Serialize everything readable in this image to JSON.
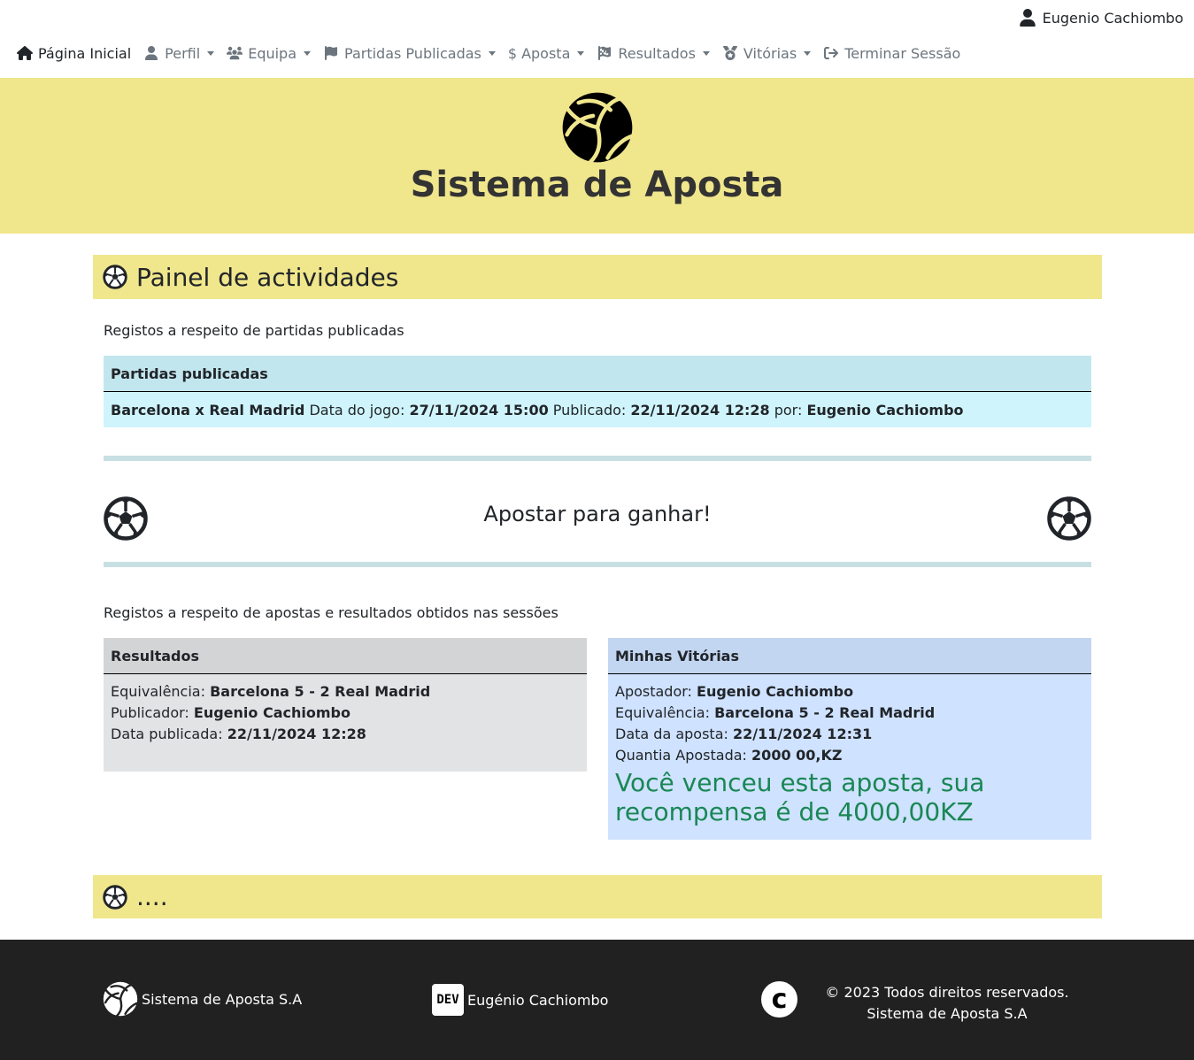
{
  "user": {
    "name": "Eugenio Cachiombo",
    "icon": "user-icon"
  },
  "nav": {
    "items": [
      {
        "label": "Página Inicial",
        "icon": "home-icon",
        "active": true,
        "dropdown": false
      },
      {
        "label": "Perfil",
        "icon": "user-icon",
        "dropdown": true
      },
      {
        "label": "Equipa",
        "icon": "users-icon",
        "dropdown": true
      },
      {
        "label": "Partidas Publicadas",
        "icon": "flag-icon",
        "dropdown": true
      },
      {
        "label": "Aposta",
        "icon": "dollar-icon",
        "dropdown": true
      },
      {
        "label": "Resultados",
        "icon": "checkered-flag-icon",
        "dropdown": true
      },
      {
        "label": "Vitórias",
        "icon": "medal-icon",
        "dropdown": true
      },
      {
        "label": "Terminar Sessão",
        "icon": "logout-icon",
        "dropdown": false
      }
    ]
  },
  "hero": {
    "title": "Sistema de Aposta",
    "logo": "volleyball-icon"
  },
  "panel": {
    "title": "Painel de actividades"
  },
  "published": {
    "caption": "Registos a respeito de partidas publicadas",
    "header": "Partidas publicadas",
    "match": "Barcelona x Real Madrid",
    "game_date_label": "Data do jogo:",
    "game_date": "27/11/2024 15:00",
    "published_label": "Publicado:",
    "published_date": "22/11/2024 12:28",
    "by_label": "por:",
    "by": "Eugenio Cachiombo"
  },
  "cta": {
    "text": "Apostar para ganhar!"
  },
  "sessions_caption": "Registos a respeito de apostas e resultados obtidos nas sessões",
  "results": {
    "header": "Resultados",
    "equiv_label": "Equivalência:",
    "equiv": "Barcelona 5 - 2 Real Madrid",
    "publisher_label": "Publicador:",
    "publisher": "Eugenio Cachiombo",
    "date_label": "Data publicada:",
    "date": "22/11/2024 12:28"
  },
  "wins": {
    "header": "Minhas Vitórias",
    "bettor_label": "Apostador:",
    "bettor": "Eugenio Cachiombo",
    "equiv_label": "Equivalência:",
    "equiv": "Barcelona 5 - 2 Real Madrid",
    "bet_date_label": "Data da aposta:",
    "bet_date": "22/11/2024 12:31",
    "amount_label": "Quantia Apostada:",
    "amount": "2000 00,KZ",
    "message": "Você venceu esta aposta, sua recompensa é de 4000,00KZ"
  },
  "bottom_panel": {
    "title": "...."
  },
  "footer": {
    "brand": "Sistema de Aposta S.A",
    "dev_badge": "DEV",
    "dev_name": "Eugénio Cachiombo",
    "copyright_line1": "© 2023 Todos direitos reservados.",
    "copyright_line2": "Sistema de Aposta S.A"
  },
  "colors": {
    "accent_yellow": "#f0e68c",
    "info_bg": "#cff4fc",
    "secondary_bg": "#e2e3e5",
    "primary_bg": "#cfe2ff",
    "success_text": "#198754",
    "footer_bg": "#212121"
  }
}
